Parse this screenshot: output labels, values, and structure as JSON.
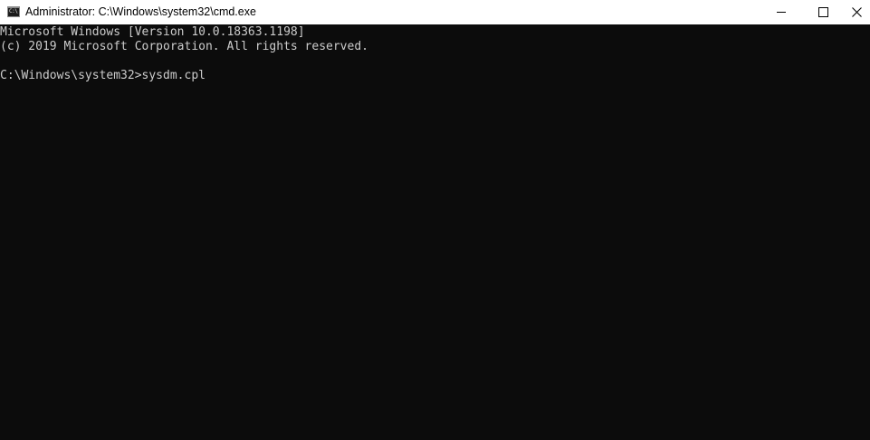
{
  "window": {
    "title": "Administrator: C:\\Windows\\system32\\cmd.exe",
    "icon": "cmd-icon",
    "icon_glyph": "C:\\",
    "controls": {
      "minimize": "minimize-icon",
      "maximize": "maximize-icon",
      "close": "✕"
    }
  },
  "console": {
    "lines": [
      "Microsoft Windows [Version 10.0.18363.1198]",
      "(c) 2019 Microsoft Corporation. All rights reserved.",
      "",
      "C:\\Windows\\system32>sysdm.cpl"
    ],
    "background_color": "#0c0c0c",
    "text_color": "#cccccc"
  }
}
